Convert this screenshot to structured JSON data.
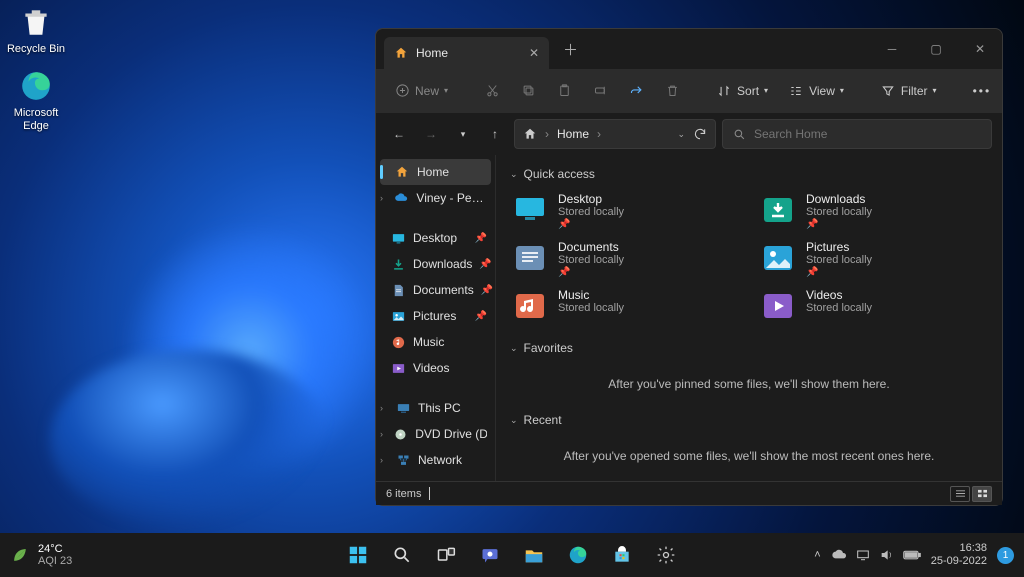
{
  "desktop_icons": {
    "recycle_bin": "Recycle Bin",
    "edge": "Microsoft Edge"
  },
  "explorer": {
    "tab_title": "Home",
    "toolbar": {
      "new": "New",
      "sort": "Sort",
      "view": "View",
      "filter": "Filter"
    },
    "address": {
      "crumb1": "Home",
      "search_placeholder": "Search Home"
    },
    "sidebar": {
      "home": "Home",
      "viney": "Viney - Personal",
      "desktop": "Desktop",
      "downloads": "Downloads",
      "documents": "Documents",
      "pictures": "Pictures",
      "music": "Music",
      "videos": "Videos",
      "thispc": "This PC",
      "dvd": "DVD Drive (D:) CCC",
      "network": "Network"
    },
    "sections": {
      "quick": "Quick access",
      "favorites": "Favorites",
      "recent": "Recent",
      "fav_empty": "After you've pinned some files, we'll show them here.",
      "recent_empty": "After you've opened some files, we'll show the most recent ones here."
    },
    "quick_access": [
      {
        "title": "Desktop",
        "sub": "Stored locally",
        "pin": true,
        "color": "#27b7e0",
        "icon": "desktop"
      },
      {
        "title": "Downloads",
        "sub": "Stored locally",
        "pin": true,
        "color": "#14a38b",
        "icon": "download"
      },
      {
        "title": "Documents",
        "sub": "Stored locally",
        "pin": true,
        "color": "#6b8fb5",
        "icon": "doc"
      },
      {
        "title": "Pictures",
        "sub": "Stored locally",
        "pin": true,
        "color": "#2aa3d8",
        "icon": "pic"
      },
      {
        "title": "Music",
        "sub": "Stored locally",
        "pin": false,
        "color": "#e0694a",
        "icon": "music"
      },
      {
        "title": "Videos",
        "sub": "Stored locally",
        "pin": false,
        "color": "#8a5cc9",
        "icon": "video"
      }
    ],
    "status": "6 items"
  },
  "taskbar": {
    "weather_temp": "24°C",
    "weather_aqi": "AQI 23",
    "time": "16:38",
    "date": "25-09-2022",
    "badge": "1"
  }
}
